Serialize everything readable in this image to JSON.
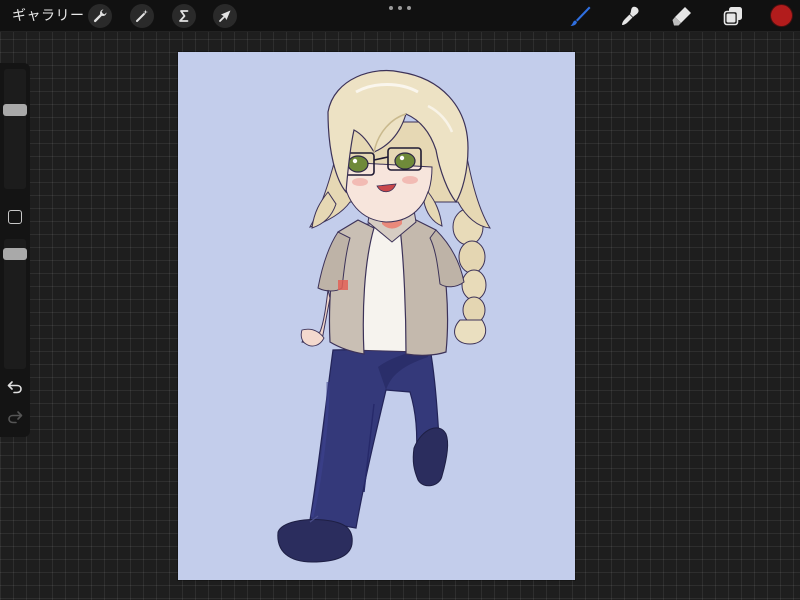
{
  "toolbar": {
    "gallery_label": "ギャラリー",
    "left_tools": [
      {
        "name": "actions",
        "icon": "wrench-icon"
      },
      {
        "name": "adjustments",
        "icon": "magic-wand-icon"
      },
      {
        "name": "selection",
        "icon": "selection-s-icon"
      },
      {
        "name": "transform",
        "icon": "arrow-cursor-icon"
      }
    ],
    "right_tools": [
      {
        "name": "brush",
        "icon": "brush-icon",
        "active": true
      },
      {
        "name": "smudge",
        "icon": "smudge-icon"
      },
      {
        "name": "eraser",
        "icon": "eraser-icon"
      },
      {
        "name": "layers",
        "icon": "layers-icon"
      }
    ],
    "active_color": "#b21c1c",
    "accent_color": "#2f6fe0"
  },
  "sidebar": {
    "brush_size_level": 0.68,
    "brush_opacity_level": 0.92,
    "undo_icon": "undo-icon",
    "redo_icon": "redo-icon",
    "modify_icon": "square-icon"
  },
  "canvas": {
    "background_color": "#c3cdeb",
    "artwork": "chibi-character-illustration"
  }
}
